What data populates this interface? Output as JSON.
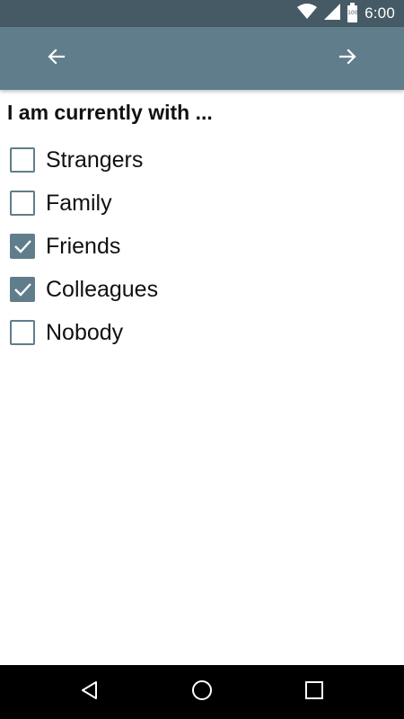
{
  "status_bar": {
    "time": "6:00",
    "battery_label": "100",
    "icons": [
      "wifi-icon",
      "cell-signal-icon",
      "battery-icon"
    ]
  },
  "toolbar": {
    "back_icon": "arrow-left-icon",
    "forward_icon": "arrow-right-icon"
  },
  "question": "I am currently with ...",
  "options": [
    {
      "label": "Strangers",
      "checked": false
    },
    {
      "label": "Family",
      "checked": false
    },
    {
      "label": "Friends",
      "checked": true
    },
    {
      "label": "Colleagues",
      "checked": true
    },
    {
      "label": "Nobody",
      "checked": false
    }
  ],
  "nav_bar": {
    "icons": [
      "back-triangle-icon",
      "home-circle-icon",
      "recents-square-icon"
    ]
  },
  "colors": {
    "status_bar": "#455a64",
    "toolbar": "#607d8b",
    "checkbox_accent": "#607d8b",
    "nav_bar": "#000000"
  }
}
